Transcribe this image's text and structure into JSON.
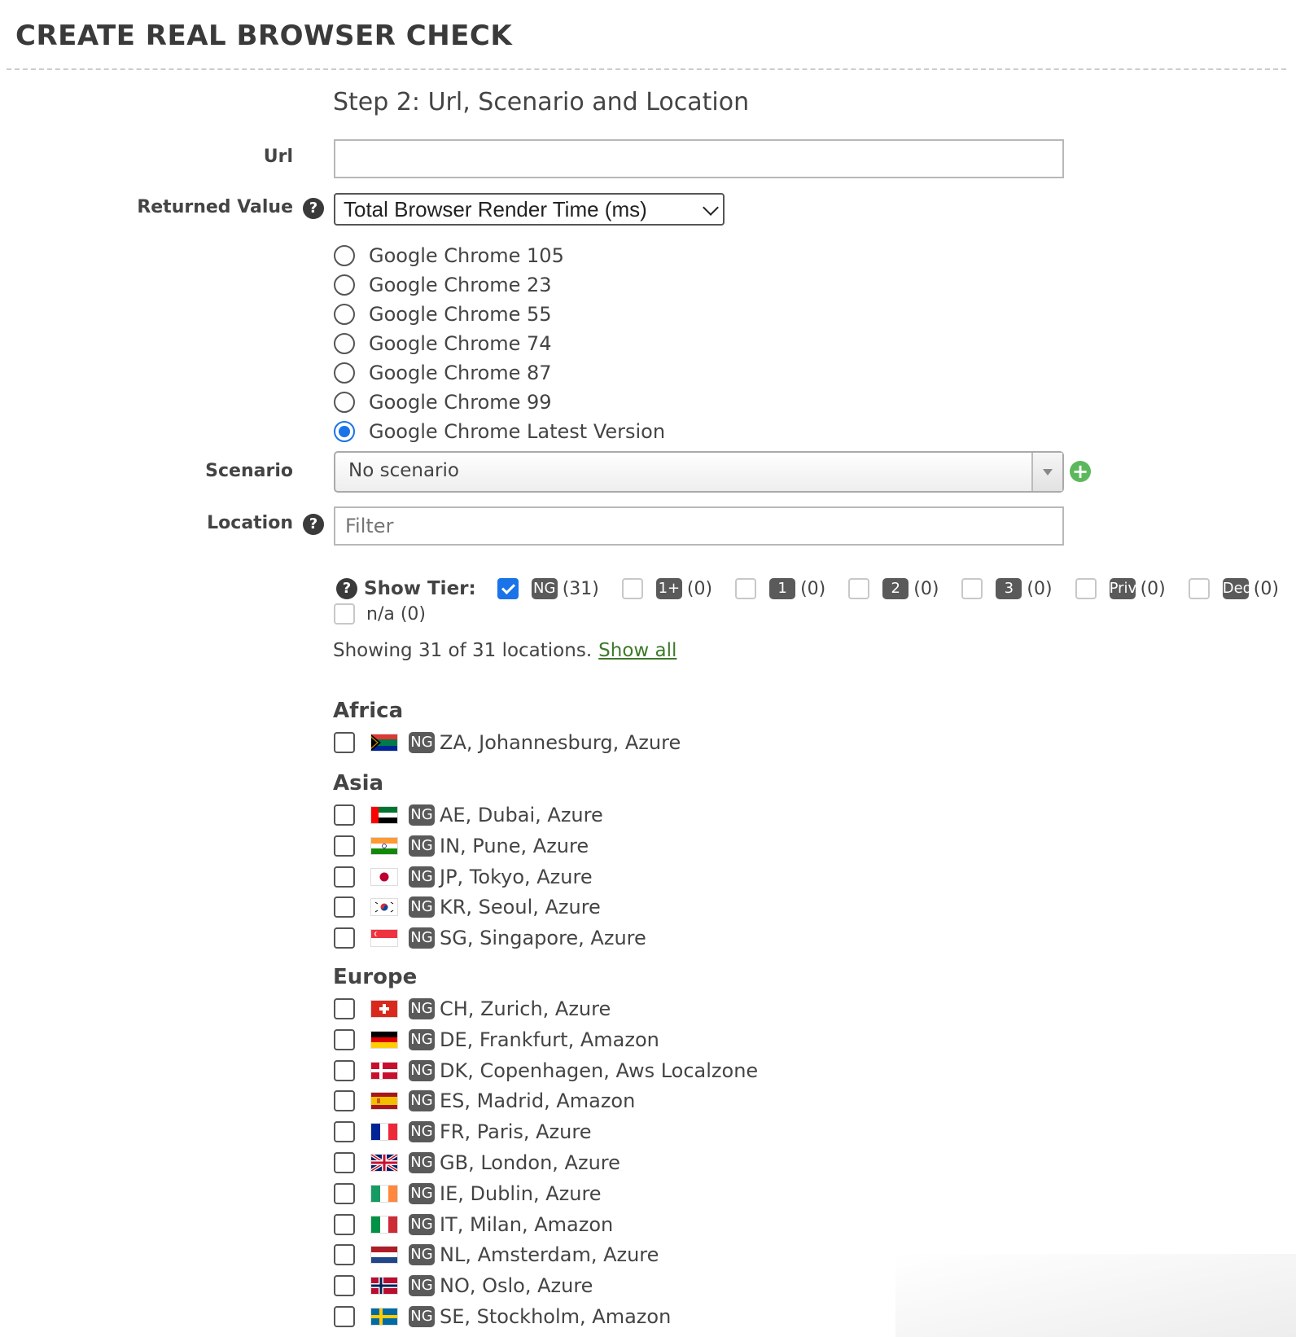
{
  "page": {
    "title": "CREATE REAL BROWSER CHECK",
    "step_title": "Step 2: Url, Scenario and Location"
  },
  "form": {
    "url_label": "Url",
    "url_value": "",
    "returned_value_label": "Returned Value",
    "returned_value_selected": "Total Browser Render Time (ms)",
    "browsers": [
      {
        "label": "Google Chrome 105",
        "checked": false
      },
      {
        "label": "Google Chrome 23",
        "checked": false
      },
      {
        "label": "Google Chrome 55",
        "checked": false
      },
      {
        "label": "Google Chrome 74",
        "checked": false
      },
      {
        "label": "Google Chrome 87",
        "checked": false
      },
      {
        "label": "Google Chrome 99",
        "checked": false
      },
      {
        "label": "Google Chrome Latest Version",
        "checked": true
      }
    ],
    "scenario_label": "Scenario",
    "scenario_selected": "No scenario",
    "location_label": "Location",
    "location_filter_placeholder": "Filter"
  },
  "tiers": {
    "label": "Show Tier:",
    "items": [
      {
        "badge": "NG",
        "count": "(31)",
        "checked": true
      },
      {
        "badge": "1+",
        "count": "(0)",
        "checked": false
      },
      {
        "badge": "1",
        "count": "(0)",
        "checked": false
      },
      {
        "badge": "2",
        "count": "(0)",
        "checked": false
      },
      {
        "badge": "3",
        "count": "(0)",
        "checked": false
      },
      {
        "badge": "Priv",
        "count": "(0)",
        "checked": false
      },
      {
        "badge": "Ded",
        "count": "(0)",
        "checked": false
      }
    ],
    "na_label": "n/a (0)",
    "na_checked": false
  },
  "showing": {
    "text": "Showing 31 of 31 locations.",
    "link": "Show all"
  },
  "regions": [
    {
      "name": "Africa",
      "locations": [
        {
          "flag": "flag-za-icon",
          "badge": "NG",
          "label": "ZA, Johannesburg, Azure",
          "checked": false
        }
      ]
    },
    {
      "name": "Asia",
      "locations": [
        {
          "flag": "flag-ae-icon",
          "badge": "NG",
          "label": "AE, Dubai, Azure",
          "checked": false
        },
        {
          "flag": "flag-in-icon",
          "badge": "NG",
          "label": "IN, Pune, Azure",
          "checked": false
        },
        {
          "flag": "flag-jp-icon",
          "badge": "NG",
          "label": "JP, Tokyo, Azure",
          "checked": false
        },
        {
          "flag": "flag-kr-icon",
          "badge": "NG",
          "label": "KR, Seoul, Azure",
          "checked": false
        },
        {
          "flag": "flag-sg-icon",
          "badge": "NG",
          "label": "SG, Singapore, Azure",
          "checked": false
        }
      ]
    },
    {
      "name": "Europe",
      "locations": [
        {
          "flag": "flag-ch-icon",
          "badge": "NG",
          "label": "CH, Zurich, Azure",
          "checked": false
        },
        {
          "flag": "flag-de-icon",
          "badge": "NG",
          "label": "DE, Frankfurt, Amazon",
          "checked": false
        },
        {
          "flag": "flag-dk-icon",
          "badge": "NG",
          "label": "DK, Copenhagen, Aws Localzone",
          "checked": false
        },
        {
          "flag": "flag-es-icon",
          "badge": "NG",
          "label": "ES, Madrid, Amazon",
          "checked": false
        },
        {
          "flag": "flag-fr-icon",
          "badge": "NG",
          "label": "FR, Paris, Azure",
          "checked": false
        },
        {
          "flag": "flag-gb-icon",
          "badge": "NG",
          "label": "GB, London, Azure",
          "checked": false
        },
        {
          "flag": "flag-ie-icon",
          "badge": "NG",
          "label": "IE, Dublin, Azure",
          "checked": false
        },
        {
          "flag": "flag-it-icon",
          "badge": "NG",
          "label": "IT, Milan, Amazon",
          "checked": false
        },
        {
          "flag": "flag-nl-icon",
          "badge": "NG",
          "label": "NL, Amsterdam, Azure",
          "checked": false
        },
        {
          "flag": "flag-no-icon",
          "badge": "NG",
          "label": "NO, Oslo, Azure",
          "checked": false
        },
        {
          "flag": "flag-se-icon",
          "badge": "NG",
          "label": "SE, Stockholm, Amazon",
          "checked": false
        }
      ]
    }
  ],
  "colors": {
    "accent": "#1a73e8",
    "badge": "#5a5a5a",
    "add": "#5cb85c",
    "link": "#3d7a2a"
  }
}
